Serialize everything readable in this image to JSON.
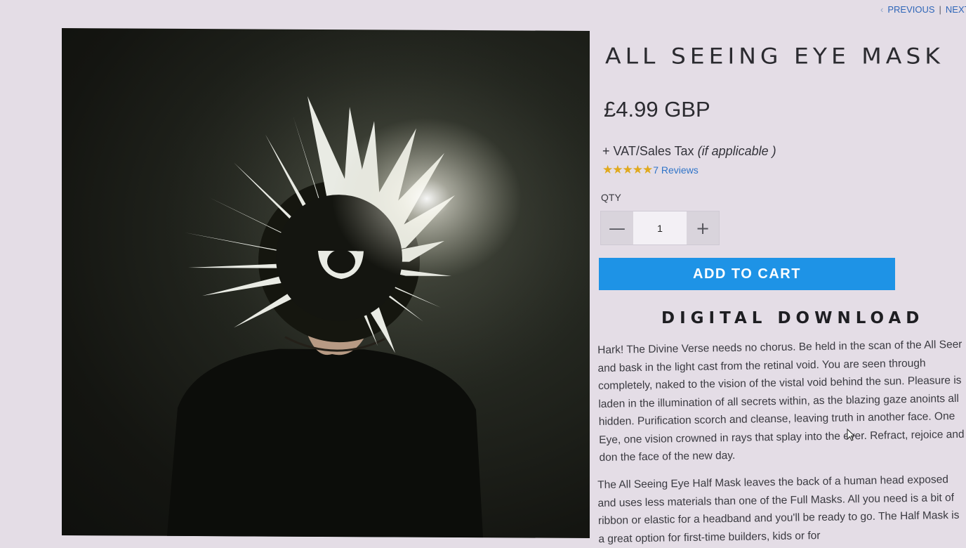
{
  "pager": {
    "previous_label": "PREVIOUS",
    "separator": "|",
    "next_label": "NEXT"
  },
  "product": {
    "title": "ALL SEEING EYE MASK",
    "price": "£4.99 GBP",
    "tax_prefix": "+ VAT/Sales Tax",
    "tax_note": "(if applicable )",
    "rating_stars": "★★★★★",
    "rating_value": 5,
    "reviews_label": "7 Reviews"
  },
  "quantity": {
    "label": "QTY",
    "decrement_symbol": "—",
    "increment_symbol": "+",
    "value": "1"
  },
  "cart": {
    "add_label": "ADD TO CART"
  },
  "description": {
    "heading": "DIGITAL DOWNLOAD",
    "paragraph_1": "Hark! The Divine Verse needs no chorus. Be held in the scan of the All Seer and bask in the light cast from the retinal void. You are seen through completely, naked to the vision of the vistal void behind the sun. Pleasure is laden in the illumination of all secrets within, as the blazing gaze anoints all hidden. Purification scorch and cleanse, leaving truth in another face. One Eye, one vision crowned in rays that splay into the ever. Refract, rejoice and don the face of the new day.",
    "paragraph_2": "The All Seeing Eye Half Mask leaves the back of a human head exposed and uses less materials than one of the Full Masks. All you need is a bit of ribbon or elastic for a headband and you'll be ready to go. The Half Mask is a great option for first-time builders, kids or for"
  },
  "colors": {
    "page_background": "#e4dde6",
    "accent_button": "#1e93e6",
    "link": "#2f74c8",
    "star": "#e0a91c",
    "text": "#2b2b30"
  }
}
